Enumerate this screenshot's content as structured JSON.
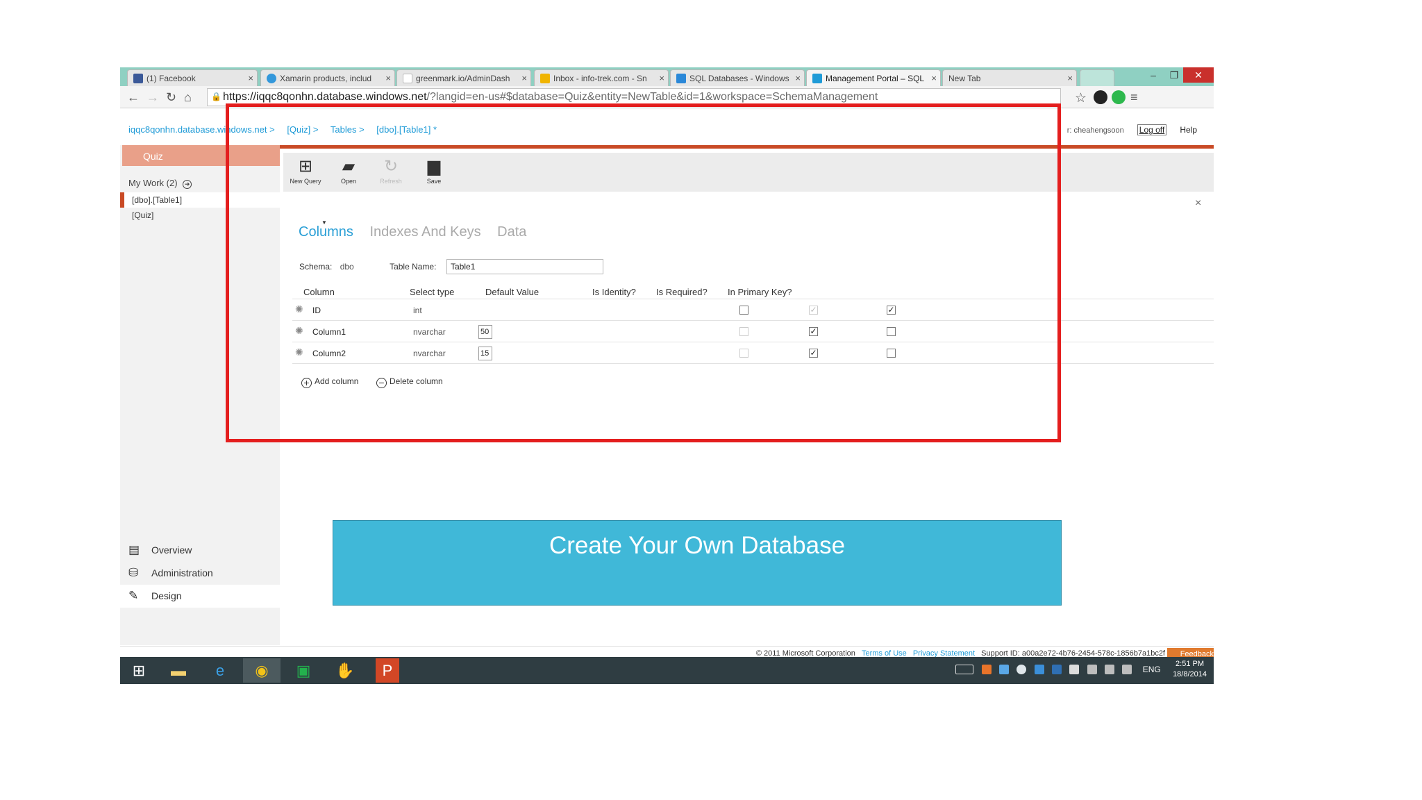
{
  "browser": {
    "tabs": [
      {
        "title": "(1) Facebook",
        "icon_color": "#3b5998"
      },
      {
        "title": "Xamarin products, includ",
        "icon_color": "#3498db"
      },
      {
        "title": "greenmark.io/AdminDash",
        "icon_color": "#cccccc"
      },
      {
        "title": "Inbox - info-trek.com - Sn",
        "icon_color": "#f0b400"
      },
      {
        "title": "SQL Databases - Windows",
        "icon_color": "#2b88d8"
      },
      {
        "title": "Management Portal – SQL",
        "icon_color": "#1f9bd7"
      },
      {
        "title": "New Tab",
        "icon_color": ""
      }
    ],
    "url_host": "https://iqqc8qonhn.database.windows.net",
    "url_rest": "/?langid=en-us#$database=Quiz&entity=NewTable&id=1&workspace=SchemaManagement"
  },
  "header": {
    "breadcrumbs": [
      "iqqc8qonhn.database.windows.net >",
      "[Quiz] >",
      "Tables >",
      "[dbo].[Table1] *"
    ],
    "user": "r: cheahengsoon",
    "logoff": "Log off",
    "help": "Help"
  },
  "sidebar": {
    "db_name": "Quiz",
    "my_work": "My Work (2)",
    "items": [
      "[dbo].[Table1]",
      "[Quiz]"
    ],
    "bottom": [
      "Overview",
      "Administration",
      "Design"
    ]
  },
  "commands": [
    "New Query",
    "Open",
    "Refresh",
    "Save"
  ],
  "designer": {
    "tabs": [
      "Columns",
      "Indexes And Keys",
      "Data"
    ],
    "schema_label": "Schema:",
    "schema_value": "dbo",
    "table_name_label": "Table Name:",
    "table_name_value": "Table1",
    "headers": [
      "Column",
      "Select type",
      "Default Value",
      "Is Identity?",
      "Is Required?",
      "In Primary Key?"
    ],
    "rows": [
      {
        "name": "ID",
        "type": "int",
        "length": "",
        "identity": false,
        "identity_enabled": true,
        "required": true,
        "required_enabled": false,
        "primary": true
      },
      {
        "name": "Column1",
        "type": "nvarchar",
        "length": "50",
        "identity": false,
        "identity_enabled": false,
        "required": true,
        "required_enabled": true,
        "primary": false
      },
      {
        "name": "Column2",
        "type": "nvarchar",
        "length": "15",
        "identity": false,
        "identity_enabled": false,
        "required": true,
        "required_enabled": true,
        "primary": false
      }
    ],
    "add_column": "Add column",
    "delete_column": "Delete column"
  },
  "banner": "Create Your Own Database",
  "footer": {
    "copyright": "© 2011 Microsoft Corporation",
    "terms": "Terms of Use",
    "privacy": "Privacy Statement",
    "support": "Support ID:  a00a2e72-4b76-2454-578c-1856b7a1bc2f",
    "feedback": "Feedback"
  },
  "taskbar": {
    "language": "ENG",
    "time": "2:51 PM",
    "date": "18/8/2014"
  },
  "colors": {
    "accent_orange": "#c94a25",
    "link_blue": "#1f9bd7",
    "highlight_red": "#e41e1e",
    "banner_blue": "#40b8d8"
  }
}
